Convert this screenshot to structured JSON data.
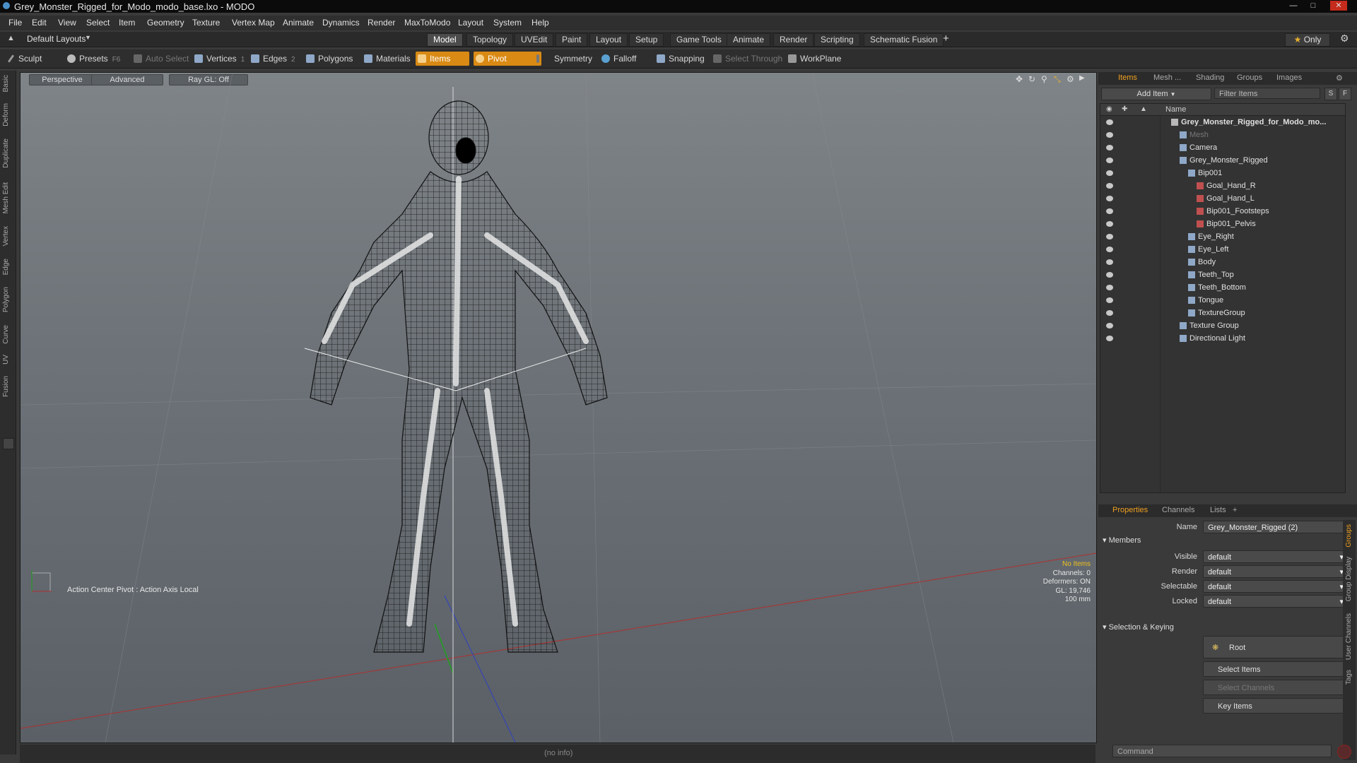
{
  "window": {
    "title": "Grey_Monster_Rigged_for_Modo_modo_base.lxo - MODO"
  },
  "menu": [
    "File",
    "Edit",
    "View",
    "Select",
    "Item",
    "Geometry",
    "Texture",
    "Vertex Map",
    "Animate",
    "Dynamics",
    "Render",
    "MaxToModo",
    "Layout",
    "System",
    "Help"
  ],
  "layout_selector": "Default Layouts",
  "layout_tabs": [
    "Model",
    "Topology",
    "UVEdit",
    "Paint",
    "Layout",
    "Setup",
    "Game Tools",
    "Animate",
    "Render",
    "Scripting",
    "Schematic Fusion"
  ],
  "layout_tab_active": "Model",
  "only_label": "Only",
  "toolbar": {
    "sculpt": "Sculpt",
    "presets": "Presets",
    "presets_key": "F6",
    "auto_select": "Auto Select",
    "vertices": "Vertices",
    "vertices_key": "1",
    "edges": "Edges",
    "edges_key": "2",
    "polygons": "Polygons",
    "materials": "Materials",
    "items": "Items",
    "pivot": "Pivot",
    "symmetry": "Symmetry",
    "falloff": "Falloff",
    "snapping": "Snapping",
    "select_through": "Select Through",
    "workplane": "WorkPlane"
  },
  "left_tabs": [
    "Basic",
    "Deform",
    "Duplicate",
    "Mesh Edit",
    "Vertex",
    "Edge",
    "Polygon",
    "Curve",
    "UV",
    "Fusion"
  ],
  "viewport": {
    "view_mode": "Perspective",
    "shading": "Advanced",
    "raygl": "Ray GL: Off",
    "action_center": "Action Center Pivot : Action Axis Local",
    "info": {
      "selection": "No Items",
      "channels": "Channels: 0",
      "deformers": "Deformers: ON",
      "gl": "GL: 19,746",
      "scale": "100 mm"
    }
  },
  "status": {
    "info": "(no info)"
  },
  "items_panel": {
    "tabs": [
      "Items",
      "Mesh ...",
      "Shading",
      "Groups",
      "Images"
    ],
    "active_tab": "Items",
    "add_item": "Add Item",
    "filter": "Filter Items",
    "s_btn": "S",
    "f_btn": "F",
    "column": "Name",
    "tree": [
      {
        "label": "Grey_Monster_Rigged_for_Modo_mo...",
        "indent": 0,
        "bold": true
      },
      {
        "label": "Mesh",
        "indent": 1,
        "dim": true
      },
      {
        "label": "Camera",
        "indent": 1
      },
      {
        "label": "Grey_Monster_Rigged",
        "indent": 1
      },
      {
        "label": "Bip001",
        "indent": 2
      },
      {
        "label": "Goal_Hand_R",
        "indent": 3
      },
      {
        "label": "Goal_Hand_L",
        "indent": 3
      },
      {
        "label": "Bip001_Footsteps",
        "indent": 3
      },
      {
        "label": "Bip001_Pelvis",
        "indent": 3
      },
      {
        "label": "Eye_Right",
        "indent": 2
      },
      {
        "label": "Eye_Left",
        "indent": 2
      },
      {
        "label": "Body",
        "indent": 2
      },
      {
        "label": "Teeth_Top",
        "indent": 2
      },
      {
        "label": "Teeth_Bottom",
        "indent": 2
      },
      {
        "label": "Tongue",
        "indent": 2
      },
      {
        "label": "TextureGroup",
        "indent": 2
      },
      {
        "label": "Texture Group",
        "indent": 1
      },
      {
        "label": "Directional Light",
        "indent": 1
      }
    ]
  },
  "properties_panel": {
    "tabs": [
      "Properties",
      "Channels",
      "Lists"
    ],
    "active_tab": "Properties",
    "name_label": "Name",
    "name_value": "Grey_Monster_Rigged (2)",
    "members_header": "Members",
    "members": [
      {
        "label": "Visible",
        "value": "default"
      },
      {
        "label": "Render",
        "value": "default"
      },
      {
        "label": "Selectable",
        "value": "default"
      },
      {
        "label": "Locked",
        "value": "default"
      }
    ],
    "selection_header": "Selection & Keying",
    "root": "Root",
    "select_items": "Select Items",
    "select_channels": "Select Channels",
    "key_items": "Key Items",
    "side_tabs": [
      "Groups",
      "Group Display",
      "User Channels",
      "Tags"
    ]
  },
  "command": {
    "placeholder": "Command"
  },
  "colors": {
    "accent": "#d98a14",
    "selected_tab": "#f0a020"
  }
}
